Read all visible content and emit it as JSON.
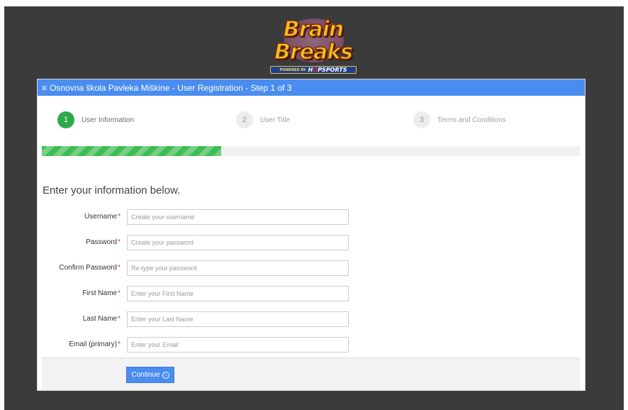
{
  "logo": {
    "word1": "Brain",
    "word2": "Breaks",
    "powered_by": "POWERED BY",
    "brand_pre": "H",
    "brand_o": "O",
    "brand_post": "PSPORTS"
  },
  "header": {
    "icon": "hamburger-icon",
    "title": "Osnovna škola Pavleka Miškine - User Registration - Step 1 of 3"
  },
  "steps": [
    {
      "number": "1",
      "label": "User Information",
      "active": true
    },
    {
      "number": "2",
      "label": "User Title",
      "active": false
    },
    {
      "number": "3",
      "label": "Terms and Conditions",
      "active": false
    }
  ],
  "progress": {
    "fraction": 0.333,
    "color": "#3ebd55"
  },
  "form": {
    "heading": "Enter your information below.",
    "required_marker": "*",
    "fields": [
      {
        "label": "Username",
        "placeholder": "Create your username",
        "value": ""
      },
      {
        "label": "Password",
        "placeholder": "Create your password",
        "value": ""
      },
      {
        "label": "Confirm Password",
        "placeholder": "Re-type your password",
        "value": ""
      },
      {
        "label": "First Name",
        "placeholder": "Enter your First Name",
        "value": ""
      },
      {
        "label": "Last Name",
        "placeholder": "Enter your Last Name",
        "value": ""
      },
      {
        "label": "Email (primary)",
        "placeholder": "Enter your Email",
        "value": ""
      }
    ],
    "continue_label": "Continue",
    "continue_icon": "arrow-right-circle-icon"
  },
  "colors": {
    "accent": "#4a8df0",
    "step_active": "#2eaa4a",
    "required": "#e0301e",
    "backdrop": "#3b3b3b"
  }
}
